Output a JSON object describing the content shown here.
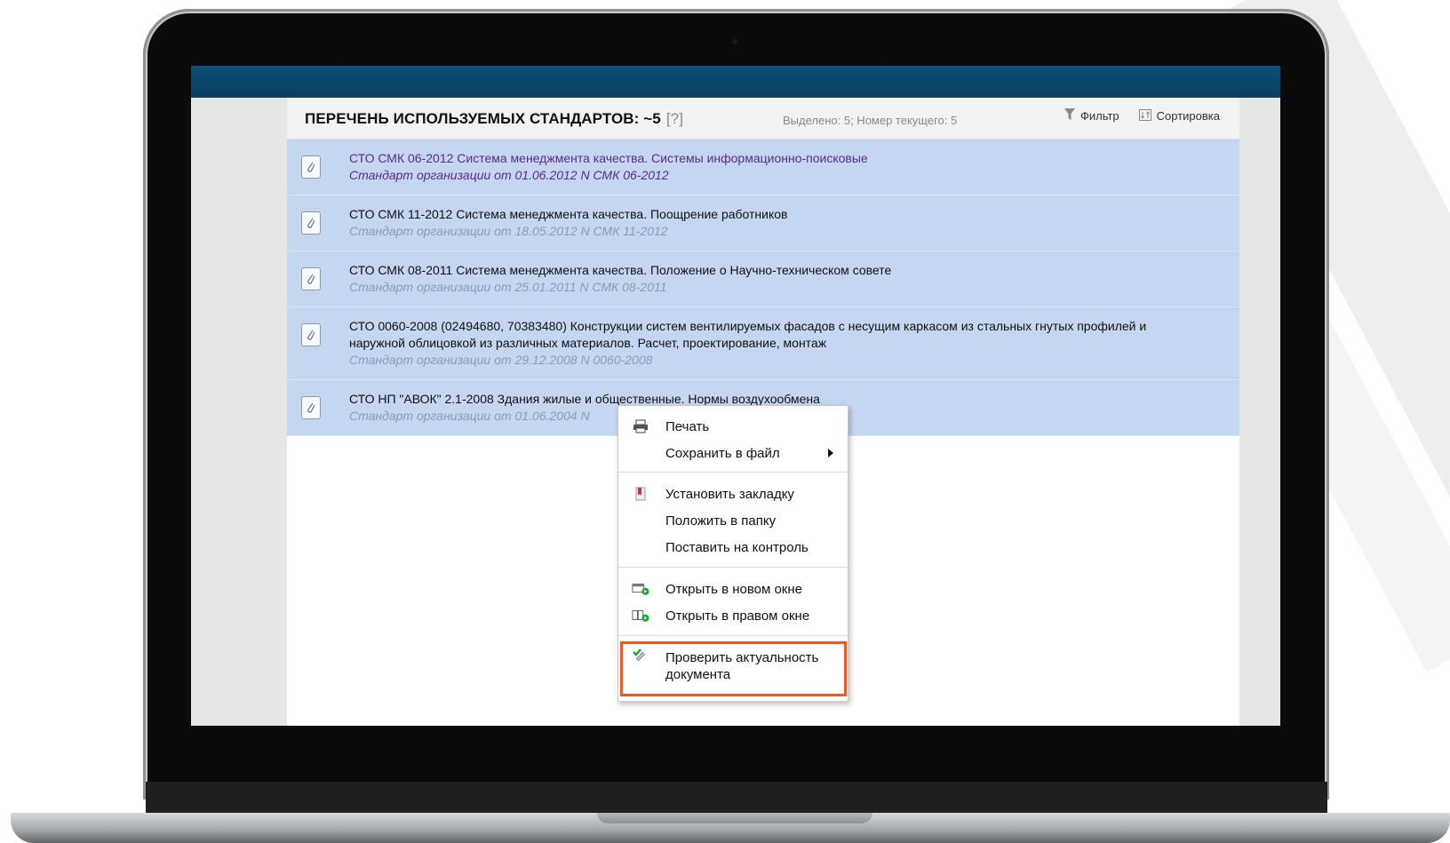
{
  "panel": {
    "title": "ПЕРЕЧЕНЬ ИСПОЛЬЗУЕМЫХ СТАНДАРТОВ: ~5",
    "help": "[?]",
    "status": "Выделено: 5; Номер текущего: 5",
    "toolbar": {
      "filter_label": "Фильтр",
      "sort_label": "Сортировка"
    }
  },
  "documents": [
    {
      "title": "СТО СМК 06-2012 Система менеджмента качества. Системы информационно-поисковые",
      "subtitle": "Стандарт организации от 01.06.2012 N СМК 06-2012"
    },
    {
      "title": "СТО СМК 11-2012 Система менеджмента качества. Поощрение работников",
      "subtitle": "Стандарт организации от 18.05.2012 N СМК 11-2012"
    },
    {
      "title": "СТО СМК 08-2011 Система менеджмента качества. Положение о Научно-техническом совете",
      "subtitle": "Стандарт организации от 25.01.2011 N СМК 08-2011"
    },
    {
      "title": "СТО 0060-2008 (02494680, 70383480) Конструкции систем вентилируемых фасадов с несущим каркасом из стальных гнутых профилей и наружной облицовкой из различных материалов. Расчет, проектирование, монтаж",
      "subtitle": "Стандарт организации от 29.12.2008 N 0060-2008"
    },
    {
      "title": "СТО НП \"АВОК\" 2.1-2008 Здания жилые и общественные. Нормы воздухообмена",
      "subtitle": "Стандарт организации от 01.06.2004 N"
    }
  ],
  "context_menu": {
    "print": "Печать",
    "save_to_file": "Сохранить в файл",
    "set_bookmark": "Установить закладку",
    "put_in_folder": "Положить в папку",
    "put_on_control": "Поставить на контроль",
    "open_new_window": "Открыть в новом окне",
    "open_right_window": "Открыть в правом окне",
    "check_relevance_line1": "Проверить актуальность",
    "check_relevance_line2": "документа"
  },
  "colors": {
    "top_bar": "#0e4e78",
    "selected_row": "#c4d6f0",
    "highlight_border": "#ee5a24",
    "visited_link": "#5b2b8c"
  }
}
